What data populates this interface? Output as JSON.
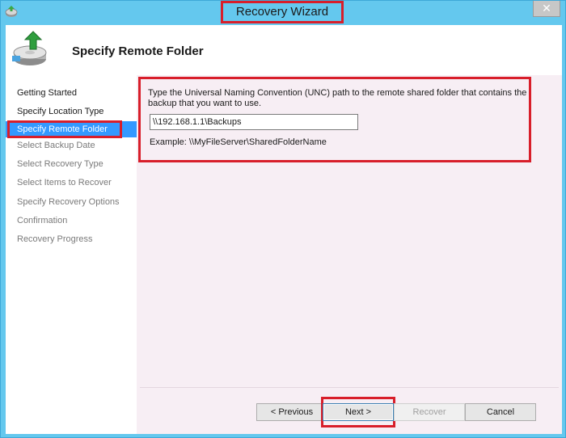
{
  "window": {
    "title": "Recovery Wizard",
    "close_label": "✕",
    "accent_color": "#64c8ee",
    "highlight_color": "#d81e2a"
  },
  "header": {
    "title": "Specify Remote Folder",
    "icon": "backup-recovery-icon"
  },
  "nav": {
    "items": [
      {
        "label": "Getting Started",
        "state": "done"
      },
      {
        "label": "Specify Location Type",
        "state": "done"
      },
      {
        "label": "Specify Remote Folder",
        "state": "active"
      },
      {
        "label": "Select Backup Date",
        "state": "pending"
      },
      {
        "label": "Select Recovery Type",
        "state": "pending"
      },
      {
        "label": "Select Items to Recover",
        "state": "pending"
      },
      {
        "label": "Specify Recovery Options",
        "state": "pending"
      },
      {
        "label": "Confirmation",
        "state": "pending"
      },
      {
        "label": "Recovery Progress",
        "state": "pending"
      }
    ]
  },
  "main": {
    "instruction": "Type the Universal Naming Convention (UNC) path to the remote shared folder that contains the backup that you want to use.",
    "unc_value": "\\\\192.168.1.1\\Backups",
    "example": "Example: \\\\MyFileServer\\SharedFolderName"
  },
  "buttons": {
    "previous": "< Previous",
    "next": "Next >",
    "recover": "Recover",
    "cancel": "Cancel"
  }
}
